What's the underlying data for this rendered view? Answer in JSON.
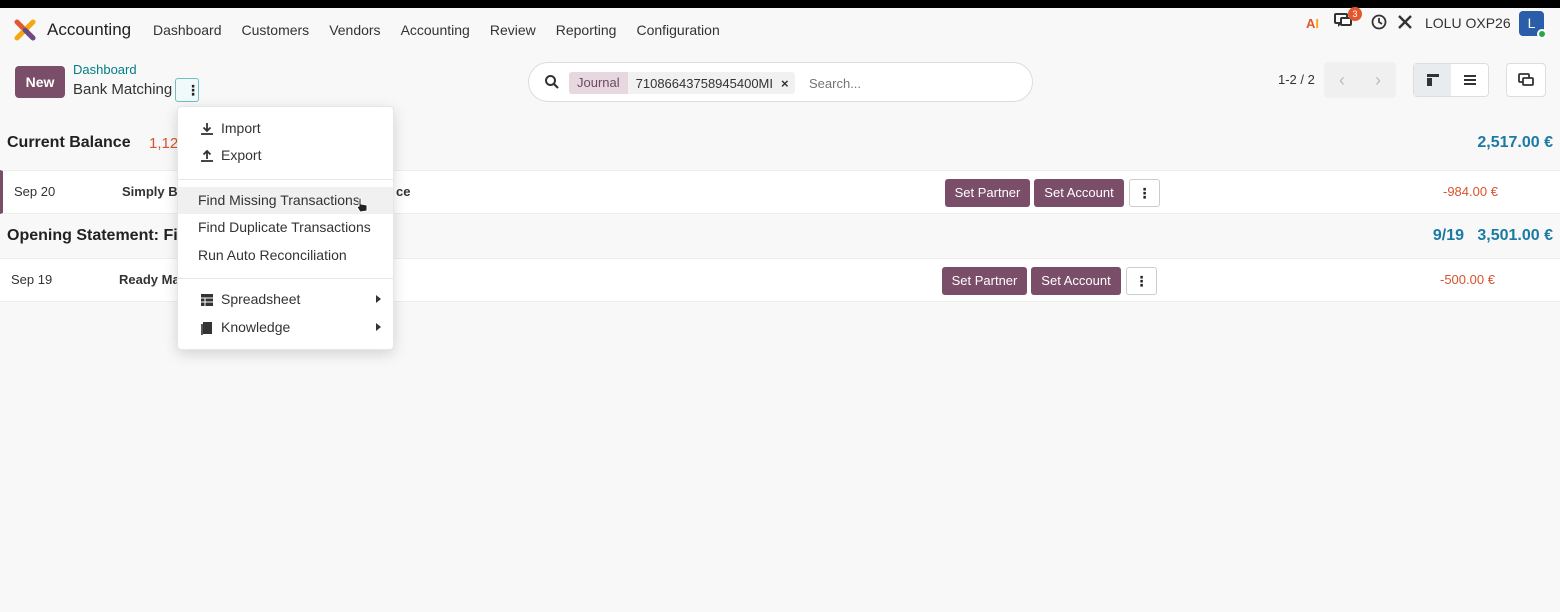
{
  "navbar": {
    "app_name": "Accounting",
    "menu": [
      "Dashboard",
      "Customers",
      "Vendors",
      "Accounting",
      "Review",
      "Reporting",
      "Configuration"
    ],
    "ai_label": "AI",
    "chat_badge": "3",
    "company": "LOLU OXP26",
    "avatar_letter": "L"
  },
  "control": {
    "new_label": "New",
    "breadcrumb_parent": "Dashboard",
    "breadcrumb_current": "Bank Matching",
    "gear_label": "⋮"
  },
  "search": {
    "facet_label": "Journal",
    "facet_value": "71086643758945400MI",
    "facet_remove": "×",
    "placeholder": "Search..."
  },
  "pager": {
    "value": "1-2 / 2",
    "prev": "‹",
    "next": "›"
  },
  "groups": [
    {
      "title": "Current Balance",
      "sub": "1,12",
      "amount": "2,517.00 €"
    },
    {
      "title": "Opening Statement: Fi",
      "count": "9/19",
      "amount": "3,501.00 €"
    }
  ],
  "lines": [
    {
      "date": "Sep 20",
      "label": "Simply Bu",
      "label_tail": "ce",
      "partner_btn": "Set Partner",
      "account_btn": "Set Account",
      "more": "⋮",
      "amount": "-984.00 €"
    },
    {
      "date": "Sep 19",
      "label": "Ready Ma",
      "partner_btn": "Set Partner",
      "account_btn": "Set Account",
      "more": "⋮",
      "amount": "-500.00 €"
    }
  ],
  "dropdown": {
    "import": "Import",
    "export": "Export",
    "find_missing": "Find Missing Transactions",
    "find_duplicate": "Find Duplicate Transactions",
    "auto_reconcile": "Run Auto Reconciliation",
    "spreadsheet": "Spreadsheet",
    "knowledge": "Knowledge"
  },
  "colors": {
    "brand": "#7a4d68",
    "link": "#017e84",
    "amount_positive": "#1a7aa3",
    "amount_negative": "#d9532d"
  }
}
